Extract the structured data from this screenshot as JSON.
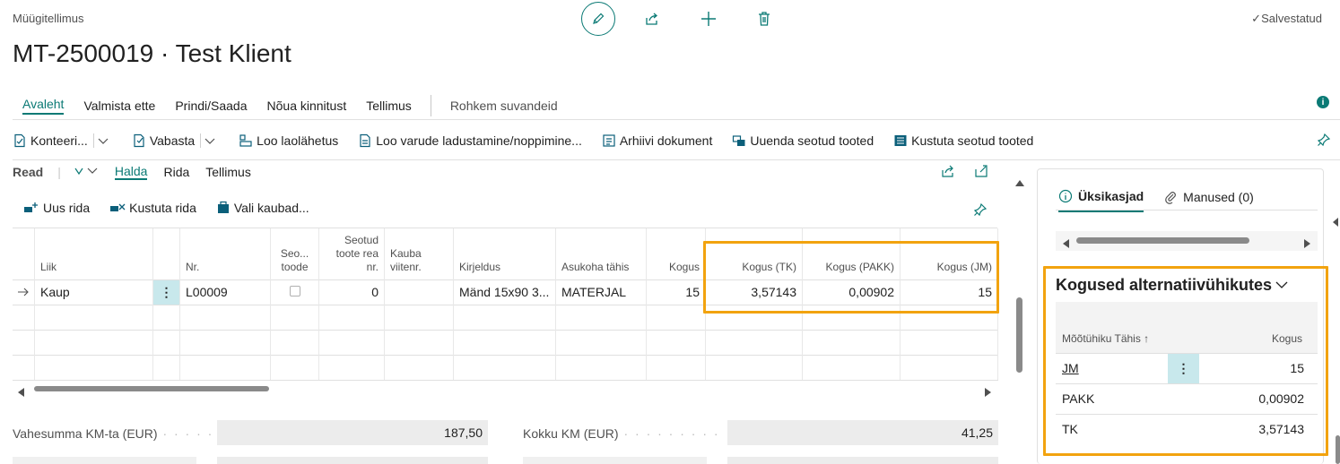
{
  "header": {
    "breadcrumb": "Müügitellimus",
    "title": "MT-2500019 · Test Klient",
    "saved_status": "Salvestatud"
  },
  "action_tabs": [
    "Avaleht",
    "Valmista ette",
    "Prindi/Saada",
    "Nõua kinnitust",
    "Tellimus"
  ],
  "more_options": "Rohkem suvandeid",
  "toolbar": {
    "items": [
      "Konteeri...",
      "Vabasta",
      "Loo laolähetus",
      "Loo varude ladustamine/noppimine...",
      "Arhiivi dokument",
      "Uuenda seotud tooted",
      "Kustuta seotud tooted"
    ]
  },
  "lines": {
    "title": "Read",
    "tabs": [
      "Halda",
      "Rida",
      "Tellimus"
    ],
    "actions": [
      "Uus rida",
      "Kustuta rida",
      "Vali kaubad..."
    ],
    "columns": {
      "liik": "Liik",
      "nr": "Nr.",
      "seotud_toode": "Seo... toode",
      "seotud_toote_rea_nr": "Seotud toote rea nr.",
      "kauba_viitenr": "Kauba viitenr.",
      "kirjeldus": "Kirjeldus",
      "asukoha_tahis": "Asukoha tähis",
      "kogus": "Kogus",
      "kogus_tk": "Kogus (TK)",
      "kogus_pakk": "Kogus (PAKK)",
      "kogus_jm": "Kogus (JM)"
    },
    "rows": [
      {
        "liik": "Kaup",
        "nr": "L00009",
        "seotud_toote_rea_nr": "0",
        "kauba_viitenr": "",
        "kirjeldus": "Mänd 15x90 3...",
        "asukoha_tahis": "MATERJAL",
        "kogus": "15",
        "kogus_tk": "3,57143",
        "kogus_pakk": "0,00902",
        "kogus_jm": "15"
      }
    ]
  },
  "totals": {
    "subtotal_label": "Vahesumma KM-ta (EUR)",
    "subtotal_value": "187,50",
    "vat_label": "Kokku KM (EUR)",
    "vat_value": "41,25"
  },
  "factbox": {
    "tabs": [
      "Üksikasjad",
      "Manused (0)"
    ],
    "alt_units_title": "Kogused alternatiivühikutes",
    "columns": {
      "unit": "Mõõtühiku Tähis ↑",
      "qty": "Kogus"
    },
    "rows": [
      {
        "unit": "JM",
        "qty": "15"
      },
      {
        "unit": "PAKK",
        "qty": "0,00902"
      },
      {
        "unit": "TK",
        "qty": "3,57143"
      }
    ]
  },
  "colors": {
    "accent": "#0b7a75",
    "highlight": "#f2a30f"
  }
}
